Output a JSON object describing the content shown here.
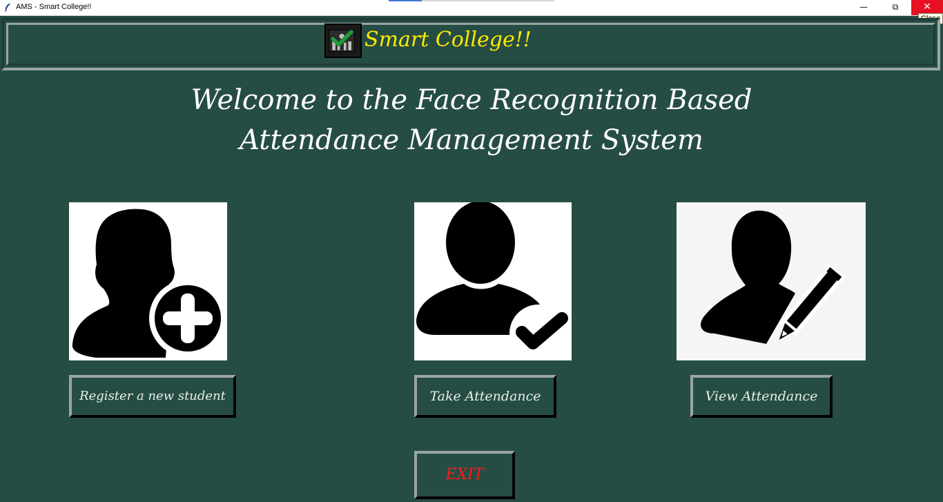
{
  "window": {
    "title": "AMS - Smart College!!",
    "minimize_glyph": "—",
    "maximize_glyph": "⧉",
    "close_glyph": "✕",
    "close_tooltip": "Close"
  },
  "header": {
    "brand": "Smart College!!",
    "logo_icon": "attendance-check-icon"
  },
  "welcome": {
    "line1": "Welcome to the Face Recognition Based",
    "line2": "Attendance Management System"
  },
  "actions": [
    {
      "icon": "user-add-icon",
      "label": "Register a new student"
    },
    {
      "icon": "user-check-icon",
      "label": "Take Attendance"
    },
    {
      "icon": "user-edit-icon",
      "label": "View Attendance"
    }
  ],
  "exit_label": "EXIT",
  "colors": {
    "background": "#264d44",
    "brand_text": "#ffea00",
    "exit_text": "#ff1a1a",
    "close_button": "#e81123"
  }
}
